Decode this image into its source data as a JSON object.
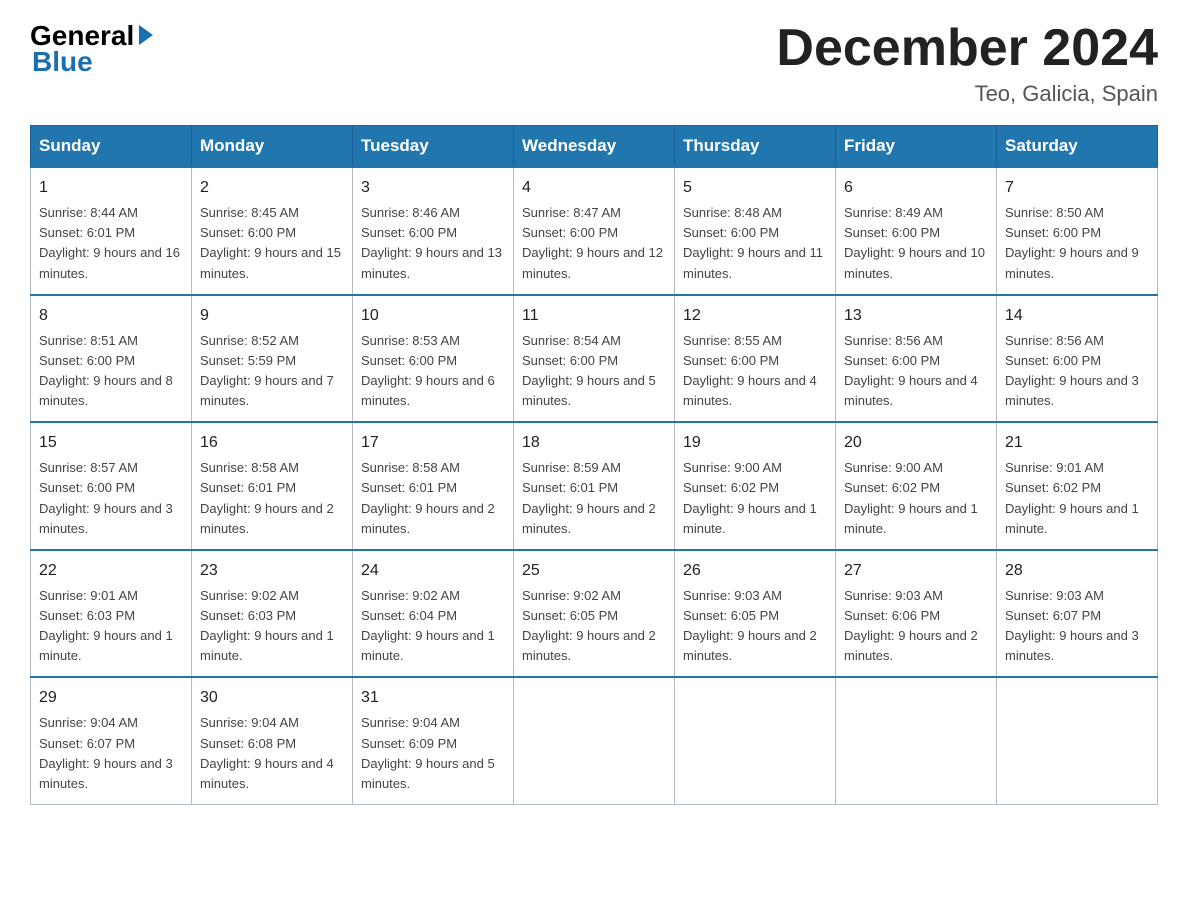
{
  "header": {
    "logo_text": "General",
    "logo_blue": "Blue",
    "month_title": "December 2024",
    "location": "Teo, Galicia, Spain"
  },
  "days_of_week": [
    "Sunday",
    "Monday",
    "Tuesday",
    "Wednesday",
    "Thursday",
    "Friday",
    "Saturday"
  ],
  "weeks": [
    [
      {
        "day": "1",
        "sunrise": "8:44 AM",
        "sunset": "6:01 PM",
        "daylight": "9 hours and 16 minutes."
      },
      {
        "day": "2",
        "sunrise": "8:45 AM",
        "sunset": "6:00 PM",
        "daylight": "9 hours and 15 minutes."
      },
      {
        "day": "3",
        "sunrise": "8:46 AM",
        "sunset": "6:00 PM",
        "daylight": "9 hours and 13 minutes."
      },
      {
        "day": "4",
        "sunrise": "8:47 AM",
        "sunset": "6:00 PM",
        "daylight": "9 hours and 12 minutes."
      },
      {
        "day": "5",
        "sunrise": "8:48 AM",
        "sunset": "6:00 PM",
        "daylight": "9 hours and 11 minutes."
      },
      {
        "day": "6",
        "sunrise": "8:49 AM",
        "sunset": "6:00 PM",
        "daylight": "9 hours and 10 minutes."
      },
      {
        "day": "7",
        "sunrise": "8:50 AM",
        "sunset": "6:00 PM",
        "daylight": "9 hours and 9 minutes."
      }
    ],
    [
      {
        "day": "8",
        "sunrise": "8:51 AM",
        "sunset": "6:00 PM",
        "daylight": "9 hours and 8 minutes."
      },
      {
        "day": "9",
        "sunrise": "8:52 AM",
        "sunset": "5:59 PM",
        "daylight": "9 hours and 7 minutes."
      },
      {
        "day": "10",
        "sunrise": "8:53 AM",
        "sunset": "6:00 PM",
        "daylight": "9 hours and 6 minutes."
      },
      {
        "day": "11",
        "sunrise": "8:54 AM",
        "sunset": "6:00 PM",
        "daylight": "9 hours and 5 minutes."
      },
      {
        "day": "12",
        "sunrise": "8:55 AM",
        "sunset": "6:00 PM",
        "daylight": "9 hours and 4 minutes."
      },
      {
        "day": "13",
        "sunrise": "8:56 AM",
        "sunset": "6:00 PM",
        "daylight": "9 hours and 4 minutes."
      },
      {
        "day": "14",
        "sunrise": "8:56 AM",
        "sunset": "6:00 PM",
        "daylight": "9 hours and 3 minutes."
      }
    ],
    [
      {
        "day": "15",
        "sunrise": "8:57 AM",
        "sunset": "6:00 PM",
        "daylight": "9 hours and 3 minutes."
      },
      {
        "day": "16",
        "sunrise": "8:58 AM",
        "sunset": "6:01 PM",
        "daylight": "9 hours and 2 minutes."
      },
      {
        "day": "17",
        "sunrise": "8:58 AM",
        "sunset": "6:01 PM",
        "daylight": "9 hours and 2 minutes."
      },
      {
        "day": "18",
        "sunrise": "8:59 AM",
        "sunset": "6:01 PM",
        "daylight": "9 hours and 2 minutes."
      },
      {
        "day": "19",
        "sunrise": "9:00 AM",
        "sunset": "6:02 PM",
        "daylight": "9 hours and 1 minute."
      },
      {
        "day": "20",
        "sunrise": "9:00 AM",
        "sunset": "6:02 PM",
        "daylight": "9 hours and 1 minute."
      },
      {
        "day": "21",
        "sunrise": "9:01 AM",
        "sunset": "6:02 PM",
        "daylight": "9 hours and 1 minute."
      }
    ],
    [
      {
        "day": "22",
        "sunrise": "9:01 AM",
        "sunset": "6:03 PM",
        "daylight": "9 hours and 1 minute."
      },
      {
        "day": "23",
        "sunrise": "9:02 AM",
        "sunset": "6:03 PM",
        "daylight": "9 hours and 1 minute."
      },
      {
        "day": "24",
        "sunrise": "9:02 AM",
        "sunset": "6:04 PM",
        "daylight": "9 hours and 1 minute."
      },
      {
        "day": "25",
        "sunrise": "9:02 AM",
        "sunset": "6:05 PM",
        "daylight": "9 hours and 2 minutes."
      },
      {
        "day": "26",
        "sunrise": "9:03 AM",
        "sunset": "6:05 PM",
        "daylight": "9 hours and 2 minutes."
      },
      {
        "day": "27",
        "sunrise": "9:03 AM",
        "sunset": "6:06 PM",
        "daylight": "9 hours and 2 minutes."
      },
      {
        "day": "28",
        "sunrise": "9:03 AM",
        "sunset": "6:07 PM",
        "daylight": "9 hours and 3 minutes."
      }
    ],
    [
      {
        "day": "29",
        "sunrise": "9:04 AM",
        "sunset": "6:07 PM",
        "daylight": "9 hours and 3 minutes."
      },
      {
        "day": "30",
        "sunrise": "9:04 AM",
        "sunset": "6:08 PM",
        "daylight": "9 hours and 4 minutes."
      },
      {
        "day": "31",
        "sunrise": "9:04 AM",
        "sunset": "6:09 PM",
        "daylight": "9 hours and 5 minutes."
      },
      null,
      null,
      null,
      null
    ]
  ]
}
